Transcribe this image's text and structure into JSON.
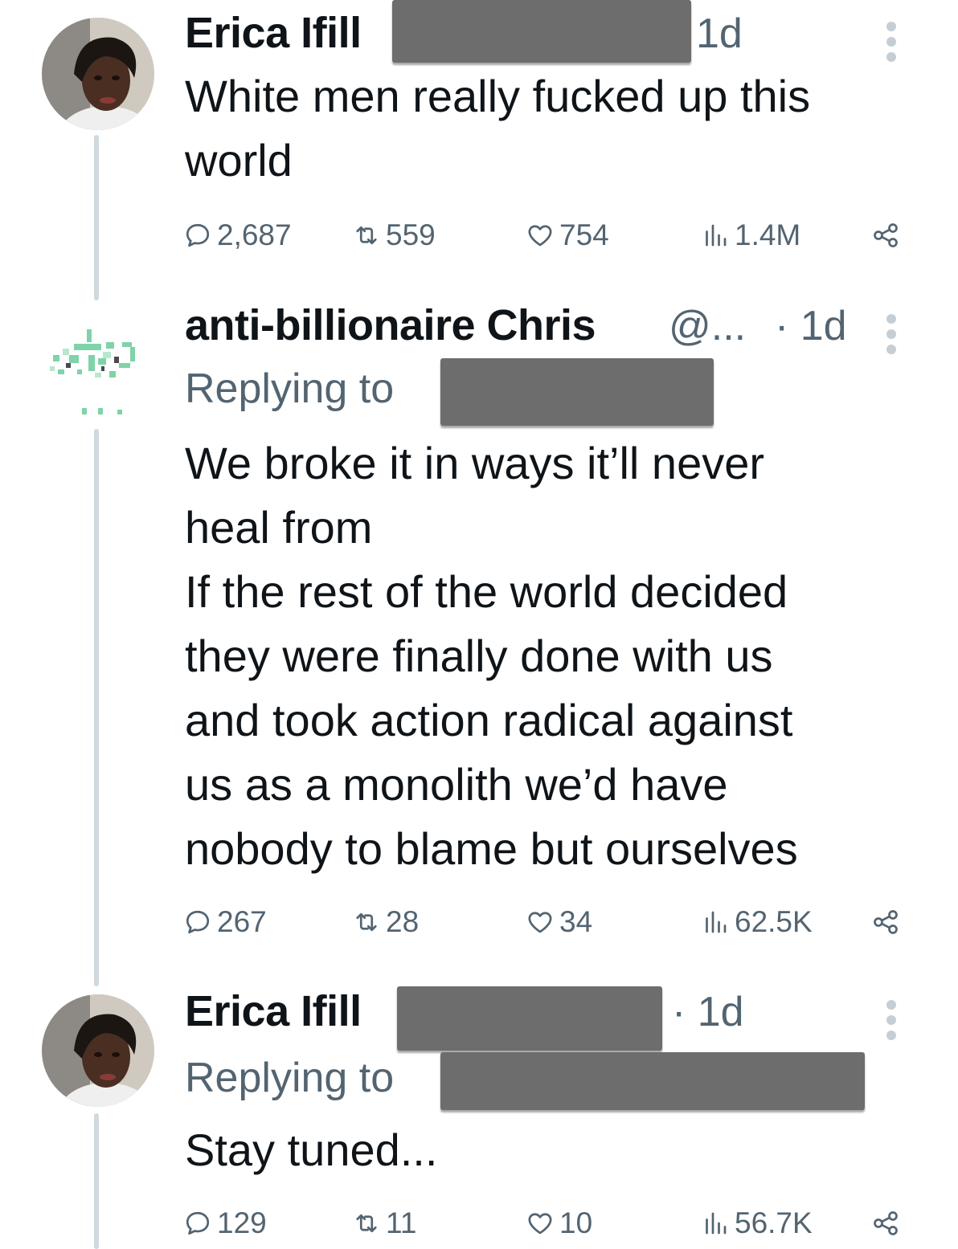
{
  "tweets": [
    {
      "author": "Erica Ifill",
      "handle": "",
      "time": "1d",
      "replying_label": "",
      "text": "White men really fucked up this\nworld",
      "replies": "2,687",
      "reposts": "559",
      "likes": "754",
      "views": "1.4M"
    },
    {
      "author": "anti-billionaire Chris",
      "handle": "@...",
      "time": "· 1d",
      "replying_label": "Replying to",
      "text": "We broke it in ways it’ll never\nheal from\nIf the rest of the world decided\nthey were finally done with us\nand took action radical against\nus as a monolith we’d have\nnobody to blame but ourselves",
      "replies": "267",
      "reposts": "28",
      "likes": "34",
      "views": "62.5K"
    },
    {
      "author": "Erica Ifill",
      "handle": "",
      "time": "· 1d",
      "replying_label": "Replying to",
      "text": "Stay tuned...",
      "replies": "129",
      "reposts": "11",
      "likes": "10",
      "views": "56.7K"
    }
  ],
  "icons": {
    "reply": "reply-icon",
    "repost": "repost-icon",
    "like": "heart-icon",
    "views": "views-icon",
    "share": "share-icon",
    "more": "more-vertical-icon"
  },
  "colors": {
    "text": "#0f1419",
    "secondary": "#536471",
    "thread_line": "#cfd9de",
    "redaction": "#6d6d6d"
  }
}
